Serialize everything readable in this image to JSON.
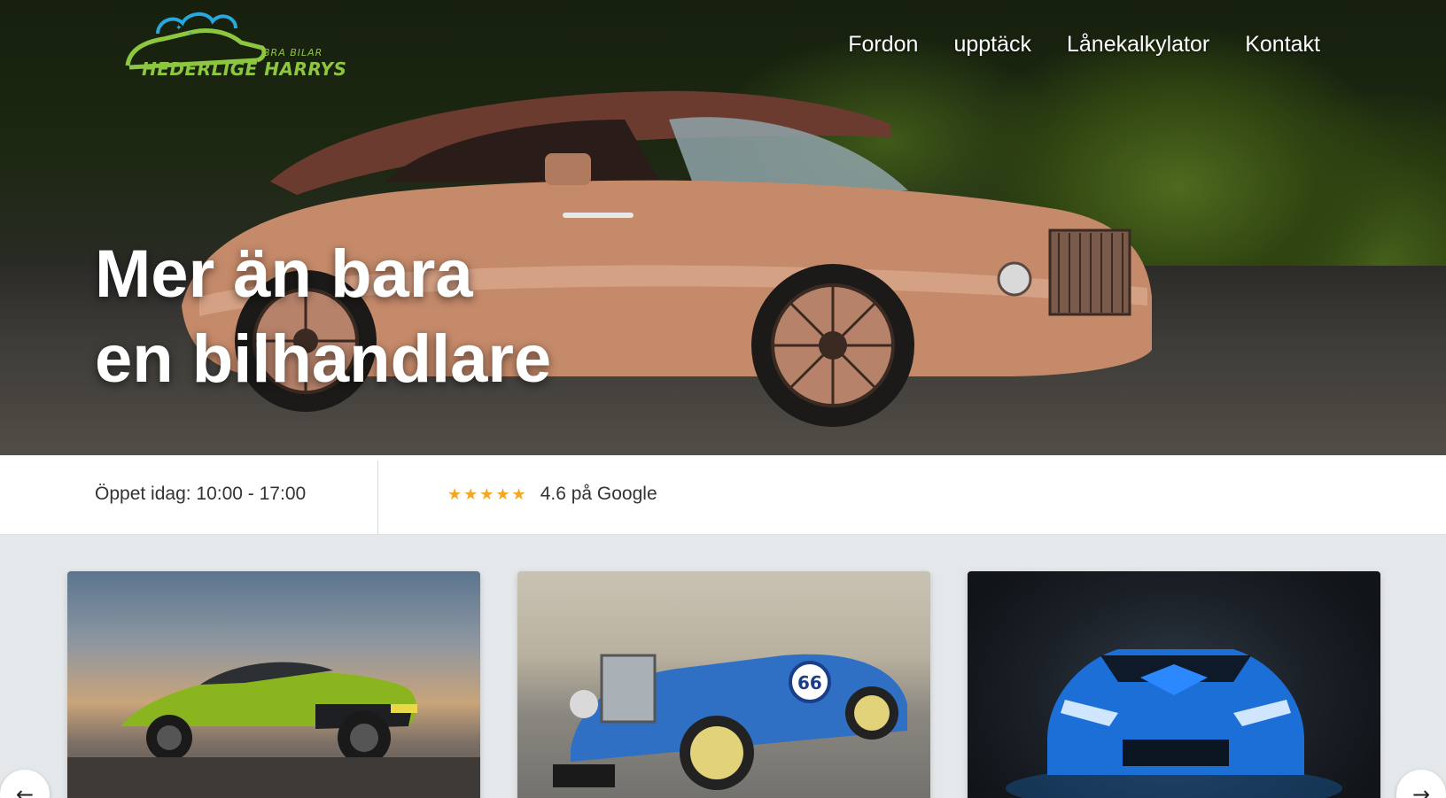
{
  "brand": {
    "name": "HEDERLIGE HARRYS",
    "tagline": "BRA BILAR"
  },
  "nav": {
    "items": [
      "Fordon",
      "upptäck",
      "Lånekalkylator",
      "Kontakt"
    ]
  },
  "hero": {
    "title_line1": "Mer än bara",
    "title_line2": "en bilhandlare"
  },
  "info": {
    "hours": "Öppet idag: 10:00 - 17:00",
    "stars": "★★★★★",
    "rating": "4.6 på Google"
  },
  "carousel": {
    "prev_arrow": "←",
    "next_arrow": "→",
    "cards": [
      {
        "name": "green-supercar"
      },
      {
        "name": "blue-vintage-roadster"
      },
      {
        "name": "blue-sports-car"
      }
    ]
  },
  "colors": {
    "brand_green": "#8dc63f",
    "brand_blue": "#29a8e0",
    "star": "#f5a623"
  }
}
